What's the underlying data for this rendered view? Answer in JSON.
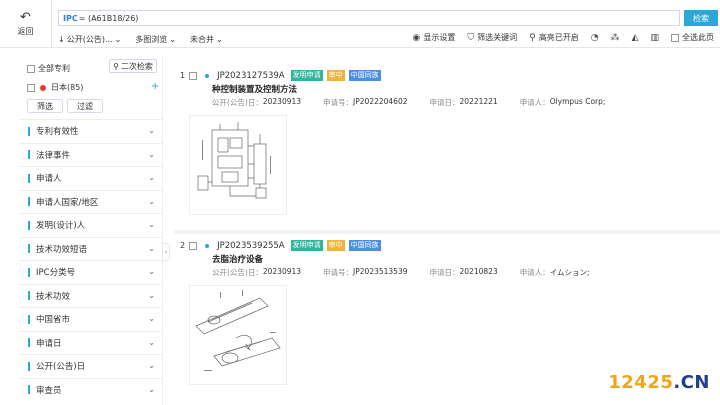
{
  "topbar": {
    "back_label": "返回",
    "query_prefix": "IPC",
    "query_rest": "= (A61B18/26)",
    "search_label": "检索"
  },
  "toolbar": {
    "sort_label": "公开(公告)...",
    "view_label": "多图浏览",
    "merge_label": "未合并",
    "display_settings": "显示设置",
    "filter_keywords": "筛选关键词",
    "highlight": "高亮已开启",
    "select_all_page": "全选此页"
  },
  "sidebar": {
    "all_patents": "全部专利",
    "second_search": "二次检索",
    "country_item": "日本(85)",
    "filter_btn": "筛选",
    "exclude_btn": "过滤",
    "facets": [
      "专利有效性",
      "法律事件",
      "申请人",
      "申请人国家/地区",
      "发明(设计)人",
      "技术功效短语",
      "IPC分类号",
      "技术功效",
      "中国省市",
      "申请日",
      "公开(公告)日",
      "审查员"
    ]
  },
  "meta_labels": {
    "pub_date": "公开(公告)日：",
    "app_no": "申请号：",
    "app_date": "申请日：",
    "applicant": "申请人："
  },
  "results": [
    {
      "index": "1",
      "pub_no": "JP2023127539A",
      "tags": [
        "发明申请",
        "审中",
        "中国同族"
      ],
      "title": "种控制装置及控制方法",
      "pub_date": "20230913",
      "app_no": "JP2022204602",
      "app_date": "20221221",
      "applicant": "Olympus Corp;"
    },
    {
      "index": "2",
      "pub_no": "JP2023539255A",
      "tags": [
        "发明申请",
        "审中",
        "中国同族"
      ],
      "title": "去脂治疗设备",
      "pub_date": "20230913",
      "app_no": "JP2023513539",
      "app_date": "20210823",
      "applicant": "イムション;"
    }
  ],
  "watermark": {
    "part_a": "12425",
    "part_b": ".CN"
  },
  "colors": {
    "accent": "#2aa9d6",
    "tag_green": "#31b59b",
    "tag_orange": "#f0b43a",
    "tag_blue": "#4a8fe0"
  }
}
